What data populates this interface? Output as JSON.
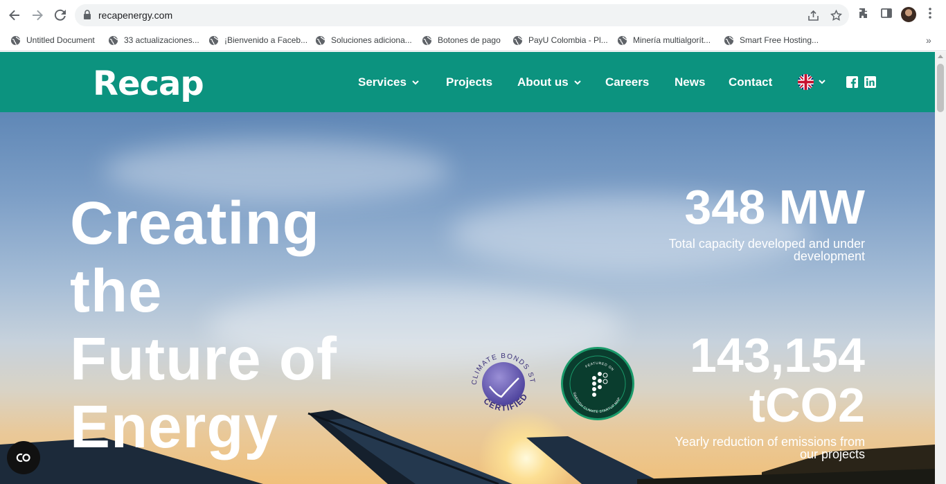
{
  "browser": {
    "url": "recapenergy.com",
    "bookmarks": [
      "Untitled Document",
      "33 actualizaciones...",
      "¡Bienvenido a Faceb...",
      "Soluciones adiciona...",
      "Botones de pago",
      "PayU Colombia - Pl...",
      "Minería multialgorít...",
      "Smart Free Hosting..."
    ],
    "bookmarks_more": "»",
    "icons": [
      "back-arrow-icon",
      "forward-arrow-icon",
      "reload-icon",
      "lock-icon",
      "share-icon",
      "star-icon",
      "extensions-icon",
      "side-panel-icon",
      "profile-avatar",
      "kebab-menu-icon",
      "globe-icon"
    ]
  },
  "site": {
    "logo": "Recap",
    "nav": {
      "services": "Services",
      "projects": "Projects",
      "about": "About us",
      "careers": "Careers",
      "news": "News",
      "contact": "Contact"
    },
    "language_flag": "uk-flag-icon",
    "social_icons": [
      "facebook-icon",
      "linkedin-icon"
    ],
    "colors": {
      "header_bg": "#0c937f",
      "text": "#ffffff"
    }
  },
  "hero": {
    "headline": [
      "Creating",
      "the",
      "Future of",
      "Energy"
    ],
    "stats": [
      {
        "value": "348 MW",
        "caption_lines": [
          "Total capacity developed and under",
          "development"
        ]
      },
      {
        "value_lines": [
          "143,154",
          "tCO2"
        ],
        "caption_lines": [
          "Yearly reduction of emissions from",
          "our projects"
        ]
      }
    ],
    "badges": {
      "cbs_top": "CLIMATE BONDS STANDARD",
      "cbs_bottom": "CERTIFIED",
      "scsm_top": "FEATURED ON",
      "scsm_bottom": "SWEDISH CLIMATE STARTUP MAP"
    }
  }
}
